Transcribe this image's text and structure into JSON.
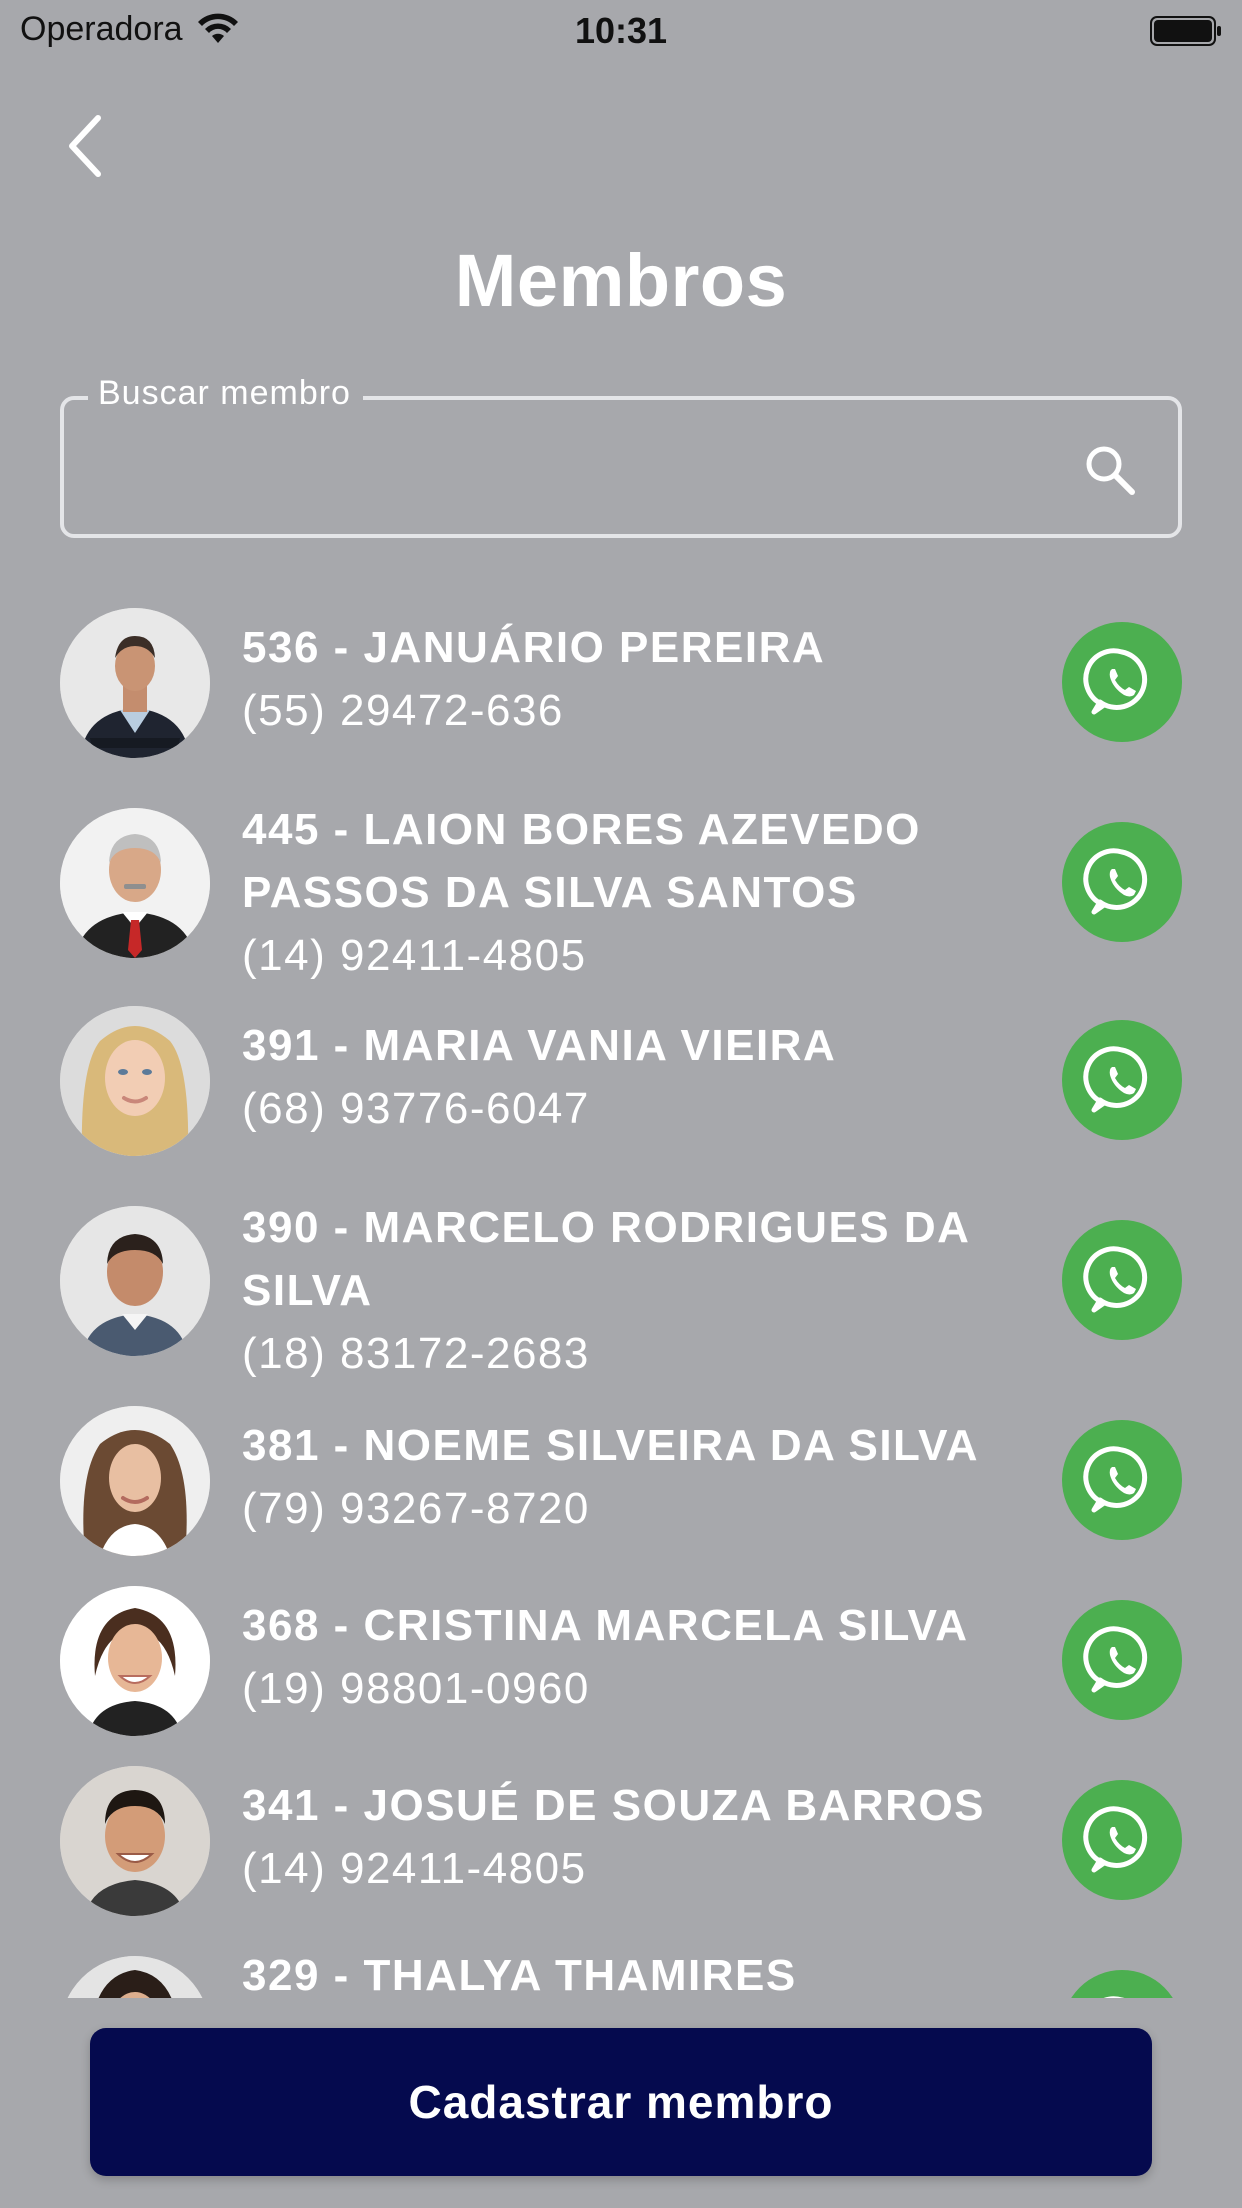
{
  "status_bar": {
    "carrier": "Operadora",
    "time": "10:31"
  },
  "header": {
    "title": "Membros"
  },
  "search": {
    "label": "Buscar membro",
    "value": "",
    "placeholder": ""
  },
  "members": [
    {
      "name": "536 - JANUÁRIO PEREIRA",
      "phone": "(55) 29472-636",
      "avatar_hint": "man-suit-arms-crossed"
    },
    {
      "name": "445 - LAION BORES AZEVEDO PASSOS DA SILVA SANTOS",
      "phone": "(14) 92411-4805",
      "avatar_hint": "older-man-red-tie"
    },
    {
      "name": "391 - MARIA VANIA VIEIRA",
      "phone": "(68) 93776-6047",
      "avatar_hint": "blonde-woman"
    },
    {
      "name": "390 - MARCELO RODRIGUES DA SILVA",
      "phone": "(18) 83172-2683",
      "avatar_hint": "man-short-hair"
    },
    {
      "name": "381 - NOEME SILVEIRA DA SILVA",
      "phone": "(79) 93267-8720",
      "avatar_hint": "woman-long-hair"
    },
    {
      "name": "368 - CRISTINA MARCELA SILVA",
      "phone": "(19) 98801-0960",
      "avatar_hint": "smiling-woman"
    },
    {
      "name": "341 - JOSUÉ DE SOUZA BARROS",
      "phone": "(14) 92411-4805",
      "avatar_hint": "smiling-young-man"
    },
    {
      "name": "329 - THALYA THAMIRES",
      "phone": "",
      "avatar_hint": "woman-dark-hair"
    }
  ],
  "actions": {
    "register_member": "Cadastrar membro"
  },
  "colors": {
    "background": "#a7a8ac",
    "whatsapp": "#4caf50",
    "primary_button": "#050a4e",
    "text": "#ffffff"
  }
}
